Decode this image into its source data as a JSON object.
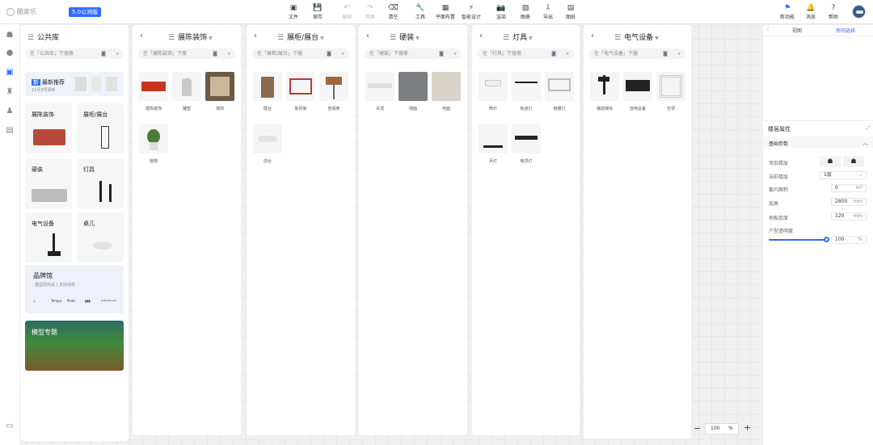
{
  "app": {
    "logo": "酷家乐",
    "version": "5.0公测版"
  },
  "toolbar": {
    "file": "文件",
    "save": "保存",
    "undo": "撤销",
    "redo": "恢复",
    "clear": "清空",
    "tools": "工具",
    "floorplan": "平面布置",
    "smart_design": "智能设计",
    "render": "渲染",
    "gallery": "图册",
    "export": "导出",
    "drawings": "图纸",
    "new_features": "新功能",
    "messages": "消息",
    "help": "帮助"
  },
  "library": {
    "title": "公共库",
    "search_placeholder": "在「公共库」下搜索",
    "banner_title": "最新推荐",
    "banner_sub": "11月3号更新",
    "categories": [
      {
        "label": "展陈装饰"
      },
      {
        "label": "展柜/展台"
      },
      {
        "label": "硬装"
      },
      {
        "label": "灯具"
      },
      {
        "label": "电气设备"
      },
      {
        "label": "桌几"
      }
    ],
    "brand_title": "品牌馆",
    "brand_sub": "模型即商品 | 支持询单",
    "brands": [
      "⊥",
      "Tempo",
      "Pinto",
      "▮▮▮",
      "bidirectional"
    ],
    "model_title": "模型专题"
  },
  "panels": [
    {
      "title": "展陈装饰",
      "search": "在「展陈装饰」下搜",
      "items": [
        "展陈装饰",
        "雕塑",
        "墙饰",
        "植物"
      ]
    },
    {
      "title": "展柜/展台",
      "search": "在「展柜/展台」下搜",
      "items": [
        "展台",
        "陈列架",
        "查阅架",
        "前台"
      ]
    },
    {
      "title": "硬装",
      "search": "在「硬装」下搜索",
      "items": [
        "吊顶",
        "墙面",
        "地面"
      ]
    },
    {
      "title": "灯具",
      "search": "在「灯具」下搜索",
      "items": [
        "筒灯",
        "轨道灯",
        "格栅灯",
        "吊灯",
        "吸顶灯"
      ]
    },
    {
      "title": "电气设备",
      "search": "在「电气设备」下搜",
      "items": [
        "播放媒体",
        "音响设备",
        "空调"
      ]
    }
  ],
  "right": {
    "tab_view": "视图",
    "tab_selection": "房间选择",
    "section_title": "楼层属性",
    "group_title": "基础参数",
    "rows": [
      {
        "label": "添加楼层",
        "value": ""
      },
      {
        "label": "当前楼层",
        "value": "1层"
      },
      {
        "label": "套内面积",
        "value": "0",
        "unit": "m²"
      },
      {
        "label": "层高",
        "value": "2800",
        "unit": "mm"
      },
      {
        "label": "地板厚度",
        "value": "120",
        "unit": "mm"
      },
      {
        "label": "户型透明度",
        "value": "100",
        "unit": "%"
      }
    ]
  },
  "zoom": {
    "value": "100",
    "unit": "%"
  }
}
